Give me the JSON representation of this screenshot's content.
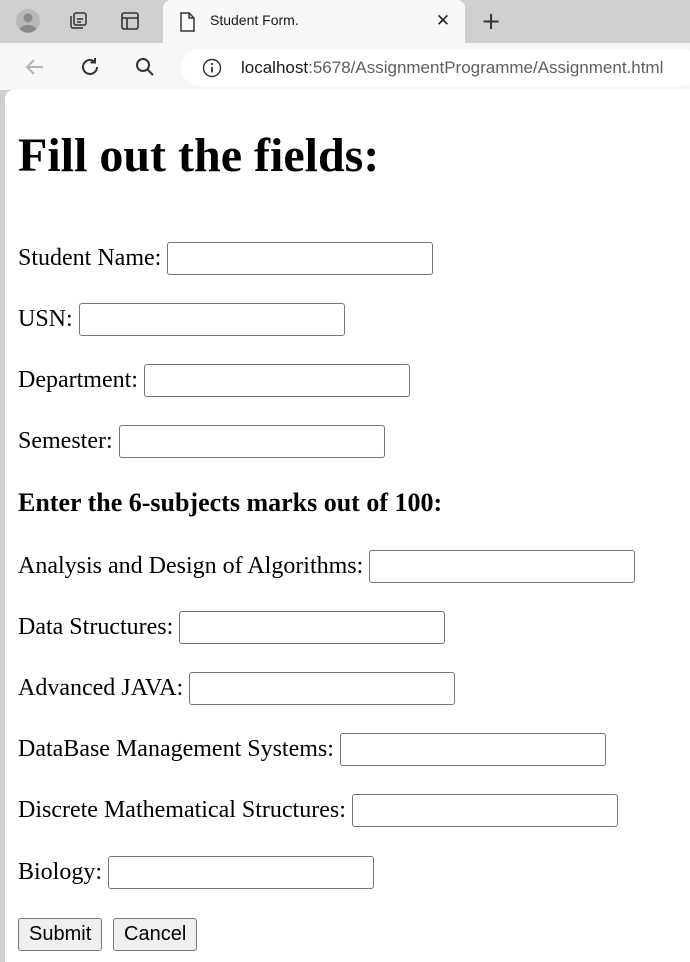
{
  "browser": {
    "tab": {
      "title": "Student Form."
    },
    "address_bar": {
      "host": "localhost",
      "path": ":5678/AssignmentProgramme/Assignment.html"
    },
    "icons": [
      "profile-icon",
      "workspaces-icon",
      "tab-actions-icon",
      "page-icon",
      "close-icon",
      "new-tab-icon",
      "back-icon",
      "reload-icon",
      "search-icon",
      "info-icon"
    ]
  },
  "form": {
    "heading": "Fill out the fields:",
    "fields": {
      "student_name": {
        "label": "Student Name:",
        "value": ""
      },
      "usn": {
        "label": "USN:",
        "value": ""
      },
      "department": {
        "label": "Department:",
        "value": ""
      },
      "semester": {
        "label": "Semester:",
        "value": ""
      }
    },
    "marks_heading": "Enter the 6-subjects marks out of 100:",
    "subjects": {
      "ada": {
        "label": "Analysis and Design of Algorithms:",
        "value": ""
      },
      "ds": {
        "label": "Data Structures:",
        "value": ""
      },
      "java": {
        "label": "Advanced JAVA:",
        "value": ""
      },
      "dbms": {
        "label": "DataBase Management Systems:",
        "value": ""
      },
      "dms": {
        "label": "Discrete Mathematical Structures:",
        "value": ""
      },
      "bio": {
        "label": "Biology:",
        "value": ""
      }
    },
    "submit_label": "Submit",
    "cancel_label": "Cancel"
  }
}
